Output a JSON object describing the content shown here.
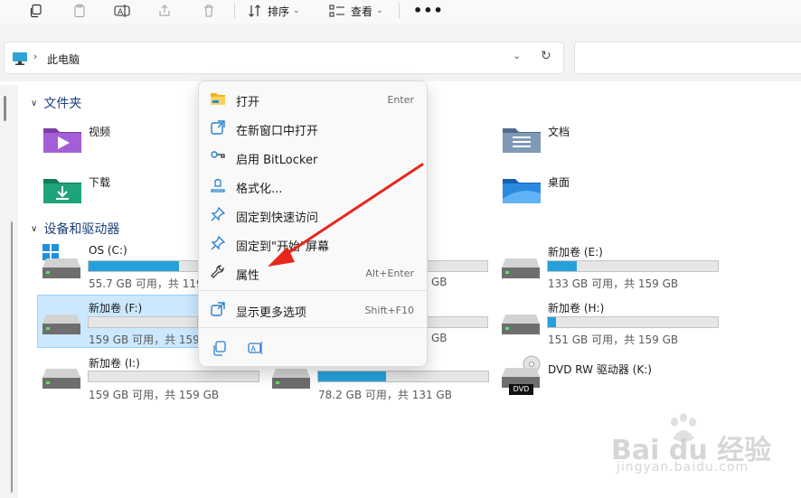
{
  "toolbar": {
    "sort_label": "排序",
    "view_label": "查看",
    "more_label": "•••"
  },
  "address": {
    "path": "此电脑"
  },
  "sections": {
    "folders": "文件夹",
    "drives": "设备和驱动器"
  },
  "folders": [
    {
      "name": "视频",
      "icon": "videos-folder-icon"
    },
    {
      "name": "文档",
      "icon": "documents-folder-icon"
    },
    {
      "name": "下载",
      "icon": "downloads-folder-icon"
    },
    {
      "name": "桌面",
      "icon": "desktop-folder-icon"
    }
  ],
  "drives": [
    {
      "name": "OS (C:)",
      "capacity": "55.7 GB 可用，共 119",
      "used_fraction": 0.53
    },
    {
      "name": "新加卷 (E:)",
      "capacity": "133 GB 可用，共 159 GB",
      "used_fraction": 0.17
    },
    {
      "name": "新加卷 (F:)",
      "capacity": "159 GB 可用，共 159",
      "used_fraction": 0.0
    },
    {
      "name": "新加卷 (H:)",
      "capacity": "151 GB 可用，共 159 GB",
      "used_fraction": 0.05
    },
    {
      "name": "新加卷 (I:)",
      "capacity": "159 GB 可用，共 159 GB",
      "used_fraction": 0.0
    },
    {
      "name": "",
      "capacity": "78.2 GB 可用，共 131 GB",
      "used_fraction": 0.4
    },
    {
      "name": "DVD RW 驱动器 (K:)",
      "badge": "DVD"
    }
  ],
  "partial_caps": {
    "e_row": "GB",
    "h_row": "GB"
  },
  "context_menu": {
    "items": [
      {
        "label": "打开",
        "shortcut": "Enter"
      },
      {
        "label": "在新窗口中打开",
        "shortcut": ""
      },
      {
        "label": "启用 BitLocker",
        "shortcut": ""
      },
      {
        "label": "格式化...",
        "shortcut": ""
      },
      {
        "label": "固定到快速访问",
        "shortcut": ""
      },
      {
        "label": "固定到\"开始\"屏幕",
        "shortcut": ""
      },
      {
        "label": "属性",
        "shortcut": "Alt+Enter"
      },
      {
        "label": "显示更多选项",
        "shortcut": "Shift+F10"
      }
    ]
  },
  "colors": {
    "accent": "#26a0da",
    "selection": "#cce8ff",
    "arrow": "#e8261c"
  },
  "watermark": {
    "brand": "Bai du 经验",
    "url": "jingyan.baidu.com"
  }
}
